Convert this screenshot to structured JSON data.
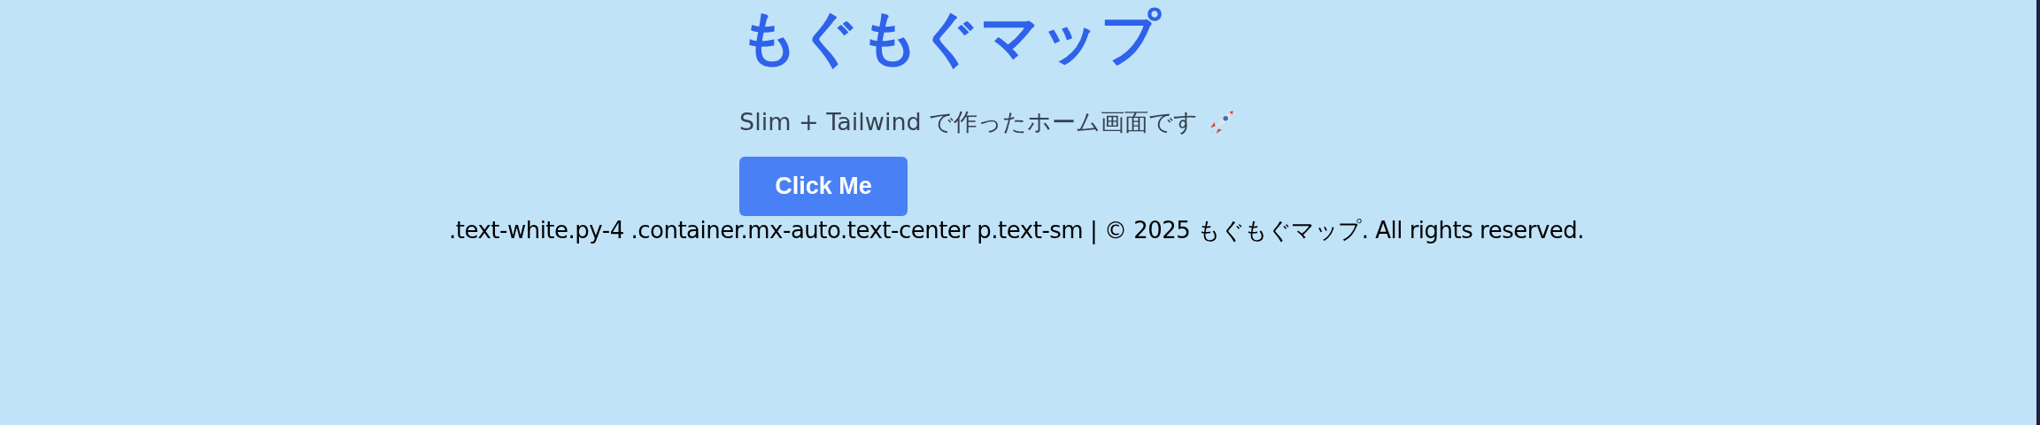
{
  "title": "もぐもぐマップ",
  "subtitle": "Slim + Tailwind で作ったホーム画面です",
  "button": {
    "label": "Click Me"
  },
  "footer": ".text-white.py-4 .container.mx-auto.text-center p.text-sm | © 2025 もぐもぐマップ. All rights reserved."
}
